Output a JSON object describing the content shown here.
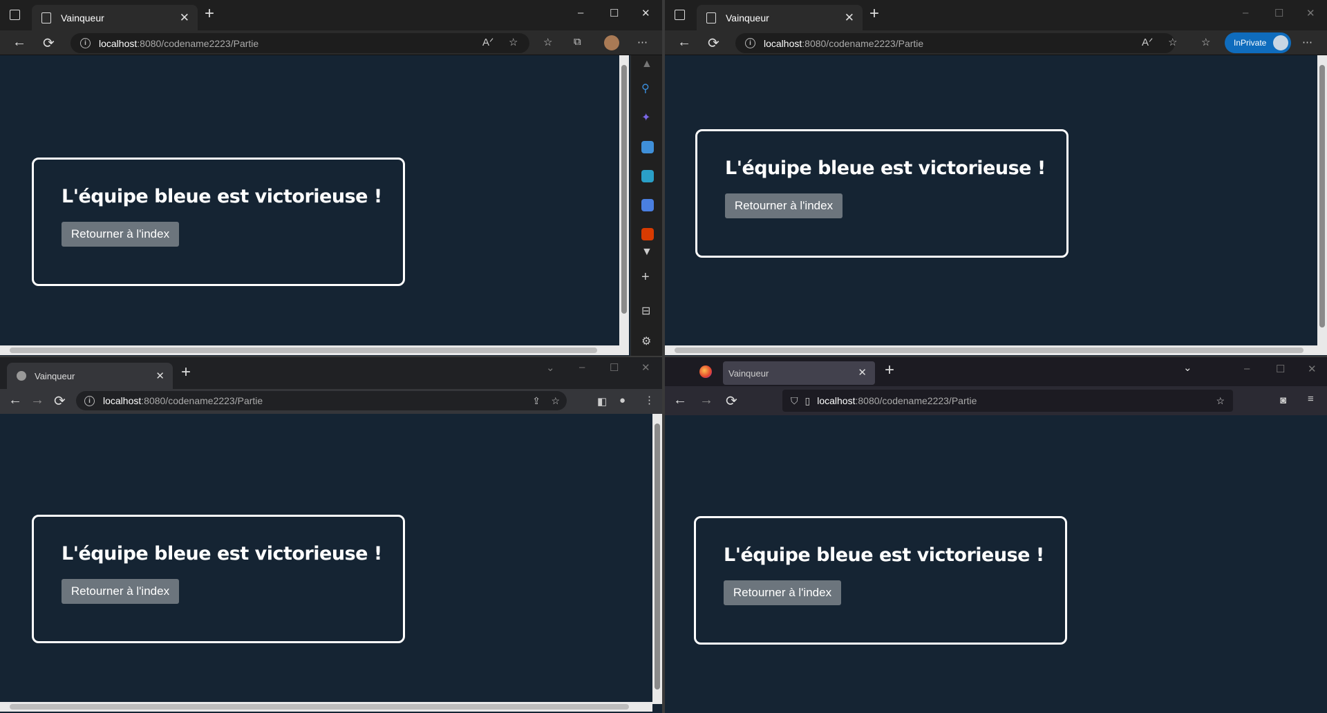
{
  "tab_title": "Vainqueur",
  "url": {
    "host": "localhost",
    "rest": ":8080/codename2223/Partie"
  },
  "heading": "L'équipe bleue est victorieuse !",
  "button_label": "Retourner à l'index",
  "inprivate_label": "InPrivate",
  "icons": {
    "min": "–",
    "max": "☐",
    "close": "✕",
    "back": "←",
    "forward": "→",
    "reload": "⟳",
    "plus": "+",
    "star": "☆",
    "menu": "⋯",
    "chevron": "⌄"
  }
}
